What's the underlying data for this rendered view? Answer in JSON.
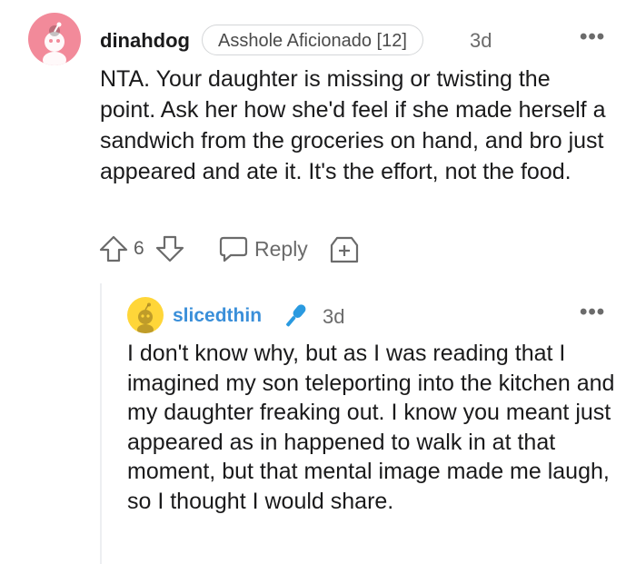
{
  "comment": {
    "username": "dinahdog",
    "flair": "Asshole Aficionado [12]",
    "time": "3d",
    "more": "•••",
    "body": "NTA. Your daughter is missing or twisting the point. Ask her how she'd feel if she made herself a sandwich from the groceries on hand, and bro just appeared and ate it. It's the effort, not the food.",
    "votes": "6",
    "reply_label": "Reply",
    "avatar_color": "#f28a9a"
  },
  "reply": {
    "username": "slicedthin",
    "time": "3d",
    "more": "•••",
    "body": "I don't know why, but as I was reading that I imagined my son teleporting into the kitchen and my daughter freaking out. I know you meant just appeared as in happened to walk in at that moment, but that mental image made me laugh, so I thought I would share.",
    "avatar_color": "#ffd639",
    "username_color": "#3a8fd9"
  }
}
